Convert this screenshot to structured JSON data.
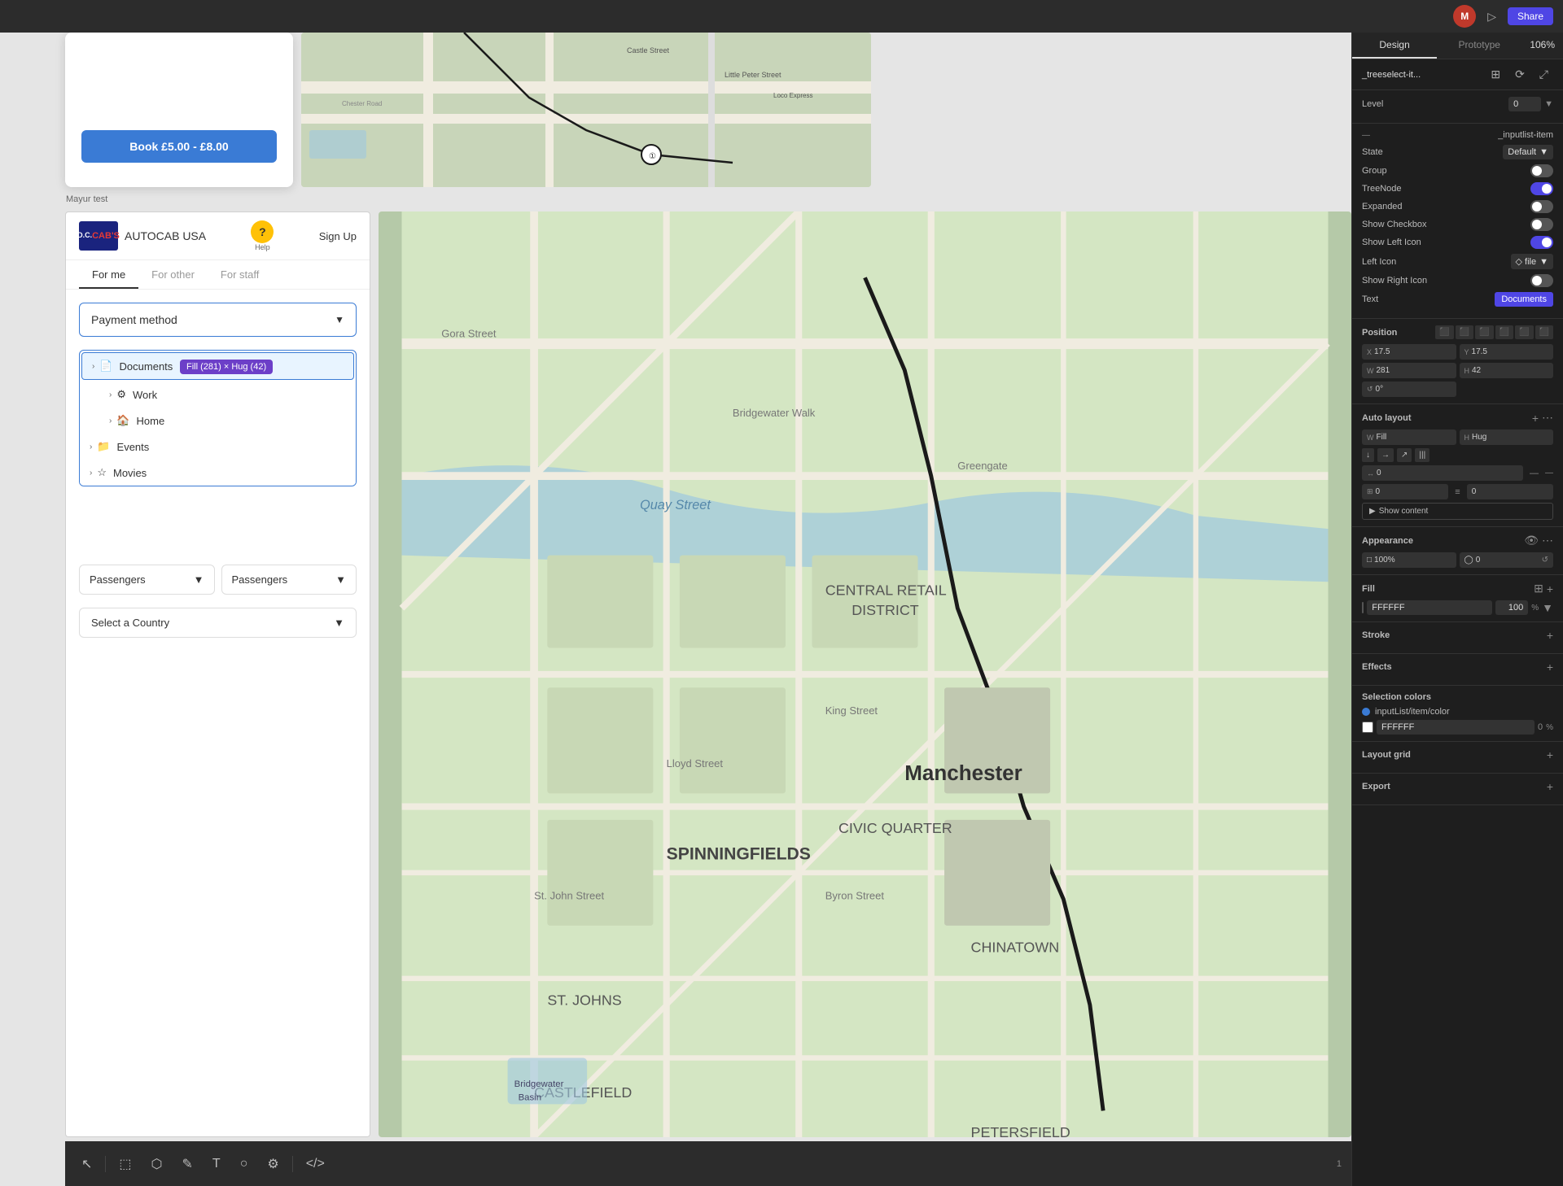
{
  "topbar": {
    "user_initial": "M",
    "zoom": "106%",
    "share_label": "Share",
    "design_tab": "Design",
    "prototype_tab": "Prototype"
  },
  "right_panel": {
    "component_name": "_treeselect-it...",
    "section_inputlist": "_inputlist-item",
    "state_label": "State",
    "state_value": "Default",
    "group_label": "Group",
    "group_toggle": false,
    "treenode_label": "TreeNode",
    "treenode_toggle": true,
    "expanded_label": "Expanded",
    "expanded_toggle": false,
    "show_checkbox_label": "Show Checkbox",
    "show_checkbox_toggle": false,
    "show_left_icon_label": "Show Left Icon",
    "show_left_icon_toggle": true,
    "left_icon_label": "Left Icon",
    "left_icon_value": "◇ file",
    "show_right_icon_label": "Show Right Icon",
    "show_right_icon_toggle": false,
    "text_label": "Text",
    "text_value": "Documents",
    "position_label": "Position",
    "x_label": "X",
    "x_value": "17.5",
    "y_label": "Y",
    "y_value": "17.5",
    "rotate_value": "0°",
    "autolayout_label": "Auto layout",
    "w_label": "W",
    "w_value": "Fill",
    "h_label": "H",
    "h_value": "Hug",
    "gap_value": "0",
    "pad_value": "0",
    "pad2_value": "0",
    "show_content_label": "Show content",
    "appearance_label": "Appearance",
    "opacity_value": "100%",
    "corner_value": "0",
    "fill_label": "Fill",
    "fill_value": "FFFFFF",
    "fill_opacity": "100",
    "stroke_label": "Stroke",
    "effects_label": "Effects",
    "selection_colors_label": "Selection colors",
    "inputlist_color_name": "inputList/item/color",
    "inputlist_color_value": "FFFFFF",
    "inputlist_color_num": "0",
    "layout_grid_label": "Layout grid",
    "export_label": "Export",
    "level_label": "Level",
    "level_value": "0"
  },
  "canvas": {
    "figma_label": "Mayur test",
    "booking_btn": "Book £5.00 - £8.00",
    "autocab_name": "AUTOCAB USA",
    "help_text": "Help",
    "signup_text": "Sign Up",
    "tabs": [
      "For me",
      "For other",
      "For staff"
    ],
    "active_tab": "For me",
    "payment_label": "Payment method",
    "tree_items": [
      {
        "label": "Documents",
        "icon": "📄",
        "level": 0,
        "selected": true
      },
      {
        "label": "Work",
        "icon": "⚙",
        "level": 1,
        "selected": false
      },
      {
        "label": "Home",
        "icon": "🏠",
        "level": 1,
        "selected": false
      },
      {
        "label": "Events",
        "icon": "📁",
        "level": 0,
        "selected": false
      },
      {
        "label": "Movies",
        "icon": "☆",
        "level": 0,
        "selected": false
      }
    ],
    "tooltip_text": "Fill (281) × Hug (42)",
    "passengers_label": "Passengers",
    "select_country_label": "Select a Country"
  },
  "toolbar": {
    "tools": [
      "↖",
      "|",
      "⬚",
      "⬡",
      "✎",
      "T",
      "○",
      "⚙",
      "< >"
    ]
  }
}
